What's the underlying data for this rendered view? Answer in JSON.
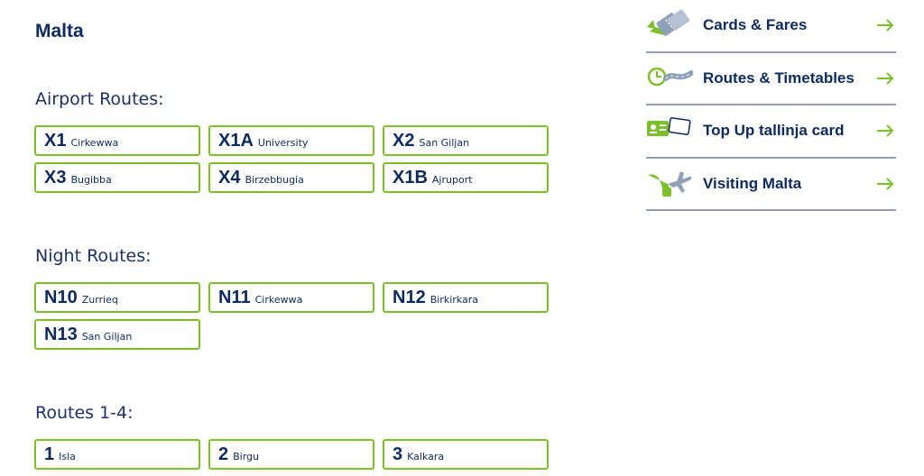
{
  "page": {
    "title": "Malta"
  },
  "sections": [
    {
      "heading": "Airport Routes:",
      "routes": [
        {
          "code": "X1",
          "dest": "Cirkewwa"
        },
        {
          "code": "X1A",
          "dest": "University"
        },
        {
          "code": "X2",
          "dest": "San Giljan"
        },
        {
          "code": "X3",
          "dest": "Bugibba"
        },
        {
          "code": "X4",
          "dest": "Birzebbugia"
        },
        {
          "code": "X1B",
          "dest": "Ajruport"
        }
      ]
    },
    {
      "heading": "Night Routes:",
      "routes": [
        {
          "code": "N10",
          "dest": "Zurrieq"
        },
        {
          "code": "N11",
          "dest": "Cirkewwa"
        },
        {
          "code": "N12",
          "dest": "Birkirkara"
        },
        {
          "code": "N13",
          "dest": "San Giljan"
        }
      ]
    },
    {
      "heading": "Routes 1-4:",
      "routes": [
        {
          "code": "1",
          "dest": "Isla"
        },
        {
          "code": "2",
          "dest": "Birgu"
        },
        {
          "code": "3",
          "dest": "Kalkara"
        }
      ]
    }
  ],
  "quick_links": [
    {
      "label": "Cards & Fares",
      "icon": "ticket-icon"
    },
    {
      "label": "Routes & Timetables",
      "icon": "clock-road-icon"
    },
    {
      "label": "Top Up tallinja card",
      "icon": "card-topup-icon"
    },
    {
      "label": "Visiting Malta",
      "icon": "airplane-icon"
    }
  ],
  "colors": {
    "accent": "#7cc12a",
    "navy": "#0d2a5e",
    "divider": "#8ea1b9"
  },
  "icons": {
    "quick_link_arrow": "arrow-right-icon"
  }
}
